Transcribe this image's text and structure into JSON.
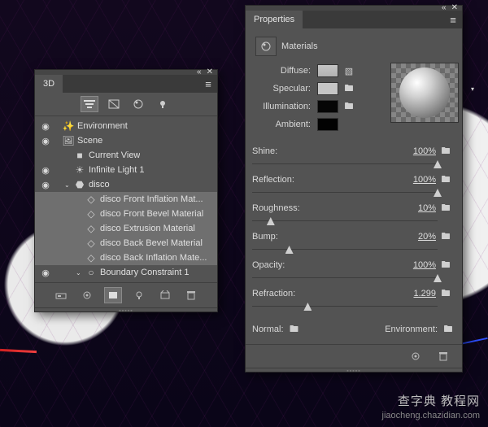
{
  "panel3d": {
    "title": "3D",
    "tree": [
      {
        "vis": "◉",
        "indent": 0,
        "arrow": "",
        "icon": "✨",
        "label": "Environment",
        "sel": false,
        "type": "environment"
      },
      {
        "vis": "◉",
        "indent": 0,
        "arrow": "",
        "icon": "🖼",
        "label": "Scene",
        "sel": false,
        "type": "scene"
      },
      {
        "vis": "",
        "indent": 1,
        "arrow": "",
        "icon": "■",
        "label": "Current View",
        "sel": false,
        "type": "camera"
      },
      {
        "vis": "◉",
        "indent": 1,
        "arrow": "",
        "icon": "☀",
        "label": "Infinite Light 1",
        "sel": false,
        "type": "light"
      },
      {
        "vis": "◉",
        "indent": 1,
        "arrow": "⌄",
        "icon": "⬣",
        "label": "disco",
        "sel": false,
        "type": "mesh"
      },
      {
        "vis": "",
        "indent": 2,
        "arrow": "",
        "icon": "◇",
        "label": "disco Front Inflation Mat...",
        "sel": true,
        "type": "material"
      },
      {
        "vis": "",
        "indent": 2,
        "arrow": "",
        "icon": "◇",
        "label": "disco Front Bevel Material",
        "sel": true,
        "type": "material"
      },
      {
        "vis": "",
        "indent": 2,
        "arrow": "",
        "icon": "◇",
        "label": "disco Extrusion Material",
        "sel": true,
        "type": "material"
      },
      {
        "vis": "",
        "indent": 2,
        "arrow": "",
        "icon": "◇",
        "label": "disco Back Bevel Material",
        "sel": true,
        "type": "material"
      },
      {
        "vis": "",
        "indent": 2,
        "arrow": "",
        "icon": "◇",
        "label": "disco Back Inflation Mate...",
        "sel": true,
        "type": "material"
      },
      {
        "vis": "◉",
        "indent": 2,
        "arrow": "⌄",
        "icon": "○",
        "label": "Boundary Constraint 1",
        "sel": false,
        "type": "constraint"
      }
    ]
  },
  "panelProps": {
    "title": "Properties",
    "subtitle": "Materials",
    "labels": {
      "diffuse": "Diffuse:",
      "specular": "Specular:",
      "illumination": "Illumination:",
      "ambient": "Ambient:",
      "normal": "Normal:",
      "environment": "Environment:"
    },
    "sliders": [
      {
        "label": "Shine:",
        "value": "100%",
        "pos": 100
      },
      {
        "label": "Reflection:",
        "value": "100%",
        "pos": 100
      },
      {
        "label": "Roughness:",
        "value": "10%",
        "pos": 10
      },
      {
        "label": "Bump:",
        "value": "20%",
        "pos": 20
      },
      {
        "label": "Opacity:",
        "value": "100%",
        "pos": 100
      },
      {
        "label": "Refraction:",
        "value": "1.299",
        "pos": 30
      }
    ]
  },
  "watermark": {
    "line1": "查字典 教程网",
    "line2": "jiaocheng.chazidian.com"
  }
}
